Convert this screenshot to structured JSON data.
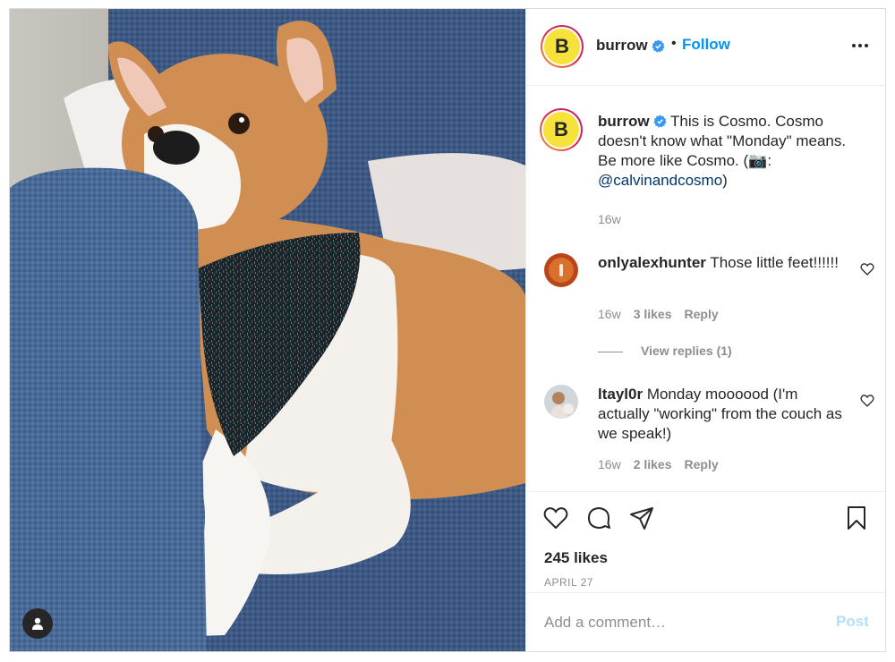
{
  "post": {
    "author": {
      "username": "burrow",
      "avatar_letter": "B",
      "verified": true,
      "follow_label": "Follow",
      "dot": "•"
    },
    "caption": {
      "username": "burrow",
      "text_before_link": " This is Cosmo. Cosmo doesn't know what \"Monday\" means. Be more like Cosmo. (📷: ",
      "link": "@calvinandcosmo",
      "text_after_link": ")",
      "time": "16w"
    },
    "comments": [
      {
        "username": "onlyalexhunter",
        "text": " Those little feet!!!!!!",
        "time": "16w",
        "likes": "3 likes",
        "reply_label": "Reply"
      },
      {
        "username": "ltayl0r",
        "text": " Monday moooood (I'm actually \"working\" from the couch as we speak!)",
        "time": "16w",
        "likes": "2 likes",
        "reply_label": "Reply"
      }
    ],
    "view_replies_label": "View replies (1)",
    "likes_label": "245 likes",
    "date": "APRIL 27",
    "add_comment": {
      "placeholder": "Add a comment…",
      "post_label": "Post"
    }
  },
  "colors": {
    "accent": "#0095f6",
    "link": "#00376b",
    "muted": "#8e8e8e",
    "post_disabled": "#b2dffc",
    "avatar_yellow": "#f6e23a"
  },
  "icons": {
    "verified": "verified-badge-icon",
    "more": "more-options-icon",
    "like": "heart-icon",
    "comment": "comment-icon",
    "share": "paper-plane-icon",
    "save": "bookmark-icon",
    "user_tag": "person-icon"
  }
}
